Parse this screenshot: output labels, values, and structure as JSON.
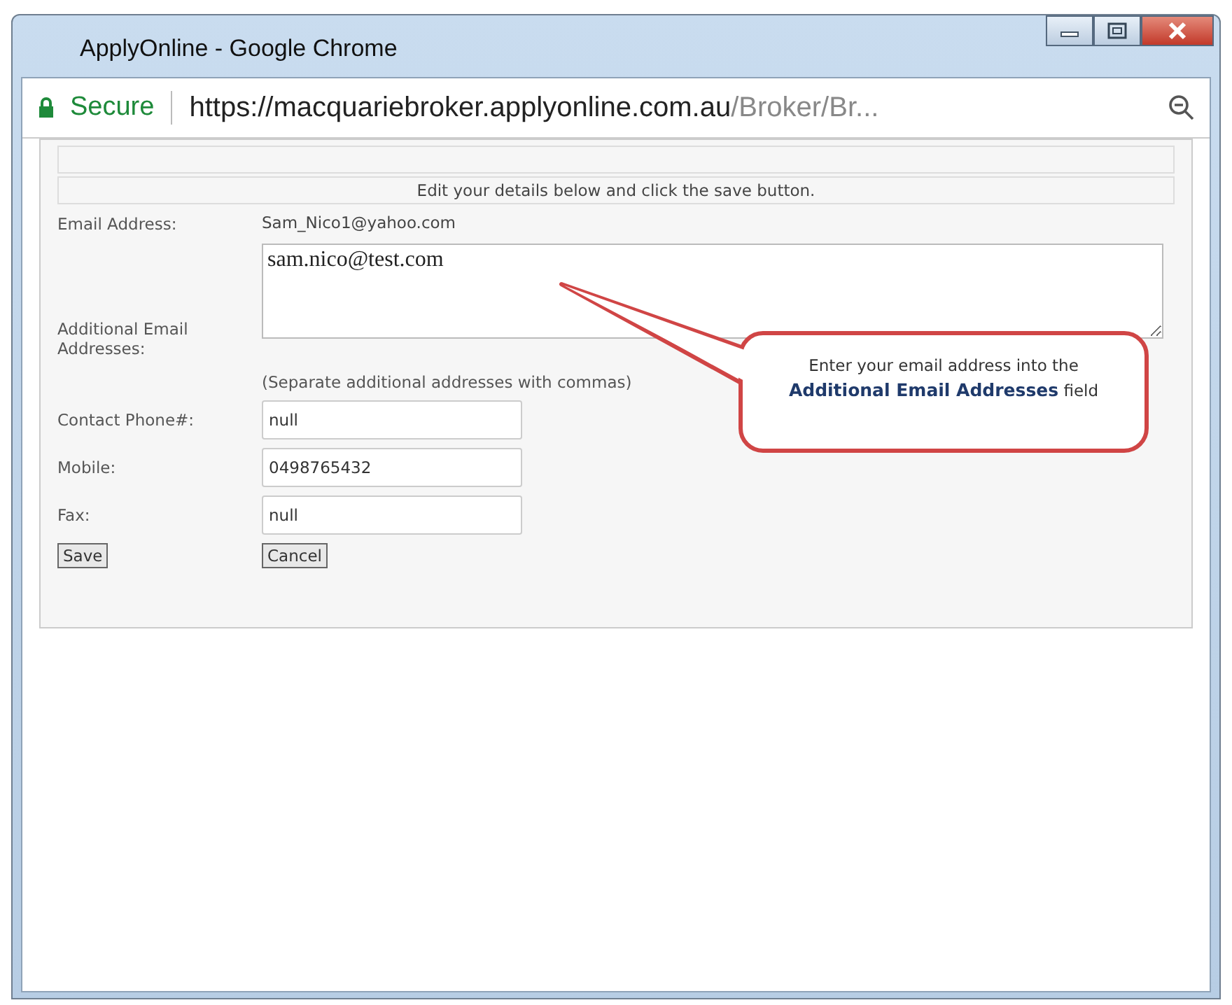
{
  "window": {
    "title": "ApplyOnline - Google Chrome"
  },
  "address_bar": {
    "secure_label": "Secure",
    "url_host": "https://macquariebroker.applyonline.com.au",
    "url_path": "/Broker/Br..."
  },
  "form": {
    "message": "Edit your details below and click the save button.",
    "email_label": "Email Address:",
    "email_value": "Sam_Nico1@yahoo.com",
    "additional_label": "Additional Email Addresses:",
    "additional_value": "sam.nico@test.com",
    "additional_note": "(Separate additional addresses with commas)",
    "fields": [
      {
        "label": "Contact Phone#:",
        "value": "null"
      },
      {
        "label": "Mobile:",
        "value": "0498765432"
      },
      {
        "label": "Fax:",
        "value": "null"
      }
    ],
    "buttons": [
      "Save",
      "Cancel"
    ]
  },
  "callout": {
    "text": "Enter your email address into the **Additional Email Addresses** field"
  }
}
